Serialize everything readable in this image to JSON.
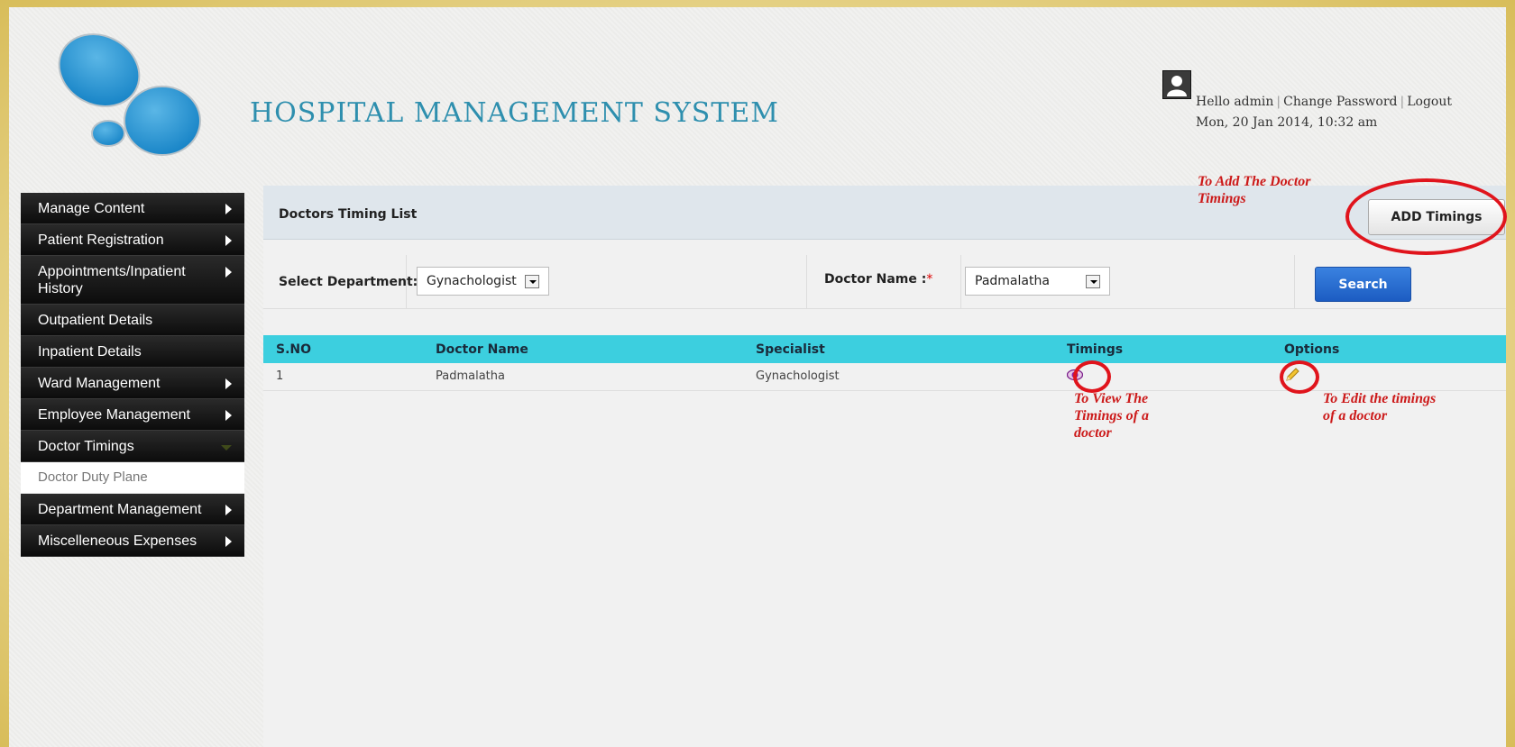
{
  "header": {
    "app_title": "HOSPITAL MANAGEMENT SYSTEM",
    "greeting": "Hello admin",
    "change_password": "Change Password",
    "logout": "Logout",
    "datetime": "Mon, 20 Jan 2014, 10:32 am"
  },
  "sidebar": {
    "items": [
      {
        "label": "Manage Content"
      },
      {
        "label": "Patient Registration"
      },
      {
        "label": "Appointments/Inpatient History"
      },
      {
        "label": "Outpatient Details"
      },
      {
        "label": "Inpatient Details"
      },
      {
        "label": "Ward Management"
      },
      {
        "label": "Employee Management"
      },
      {
        "label": "Doctor Timings"
      },
      {
        "label": "Doctor Duty Plane"
      },
      {
        "label": "Department Management"
      },
      {
        "label": "Miscelleneous Expenses"
      }
    ]
  },
  "main": {
    "title": "Doctors Timing List",
    "add_button": "ADD Timings",
    "department_label": "Select Department:",
    "department_value": "Gynachologist",
    "doctor_label": "Doctor Name :",
    "doctor_value": "Padmalatha",
    "required_mark": "*",
    "search_button": "Search",
    "table": {
      "headers": [
        "S.NO",
        "Doctor Name",
        "Specialist",
        "Timings",
        "Options"
      ],
      "rows": [
        {
          "sno": "1",
          "doctor": "Padmalatha",
          "specialist": "Gynachologist"
        }
      ]
    }
  },
  "annotations": {
    "add": [
      "To Add The Doctor",
      "Timings"
    ],
    "view": [
      "To View The",
      "Timings of a",
      "doctor"
    ],
    "edit": [
      "To Edit the timings",
      "of a doctor"
    ]
  },
  "colors": {
    "title_blue": "#2e8fae",
    "table_header": "#3ccfdf",
    "annotation_red": "#cc1a1a",
    "search_blue": "#1c5cc2"
  }
}
